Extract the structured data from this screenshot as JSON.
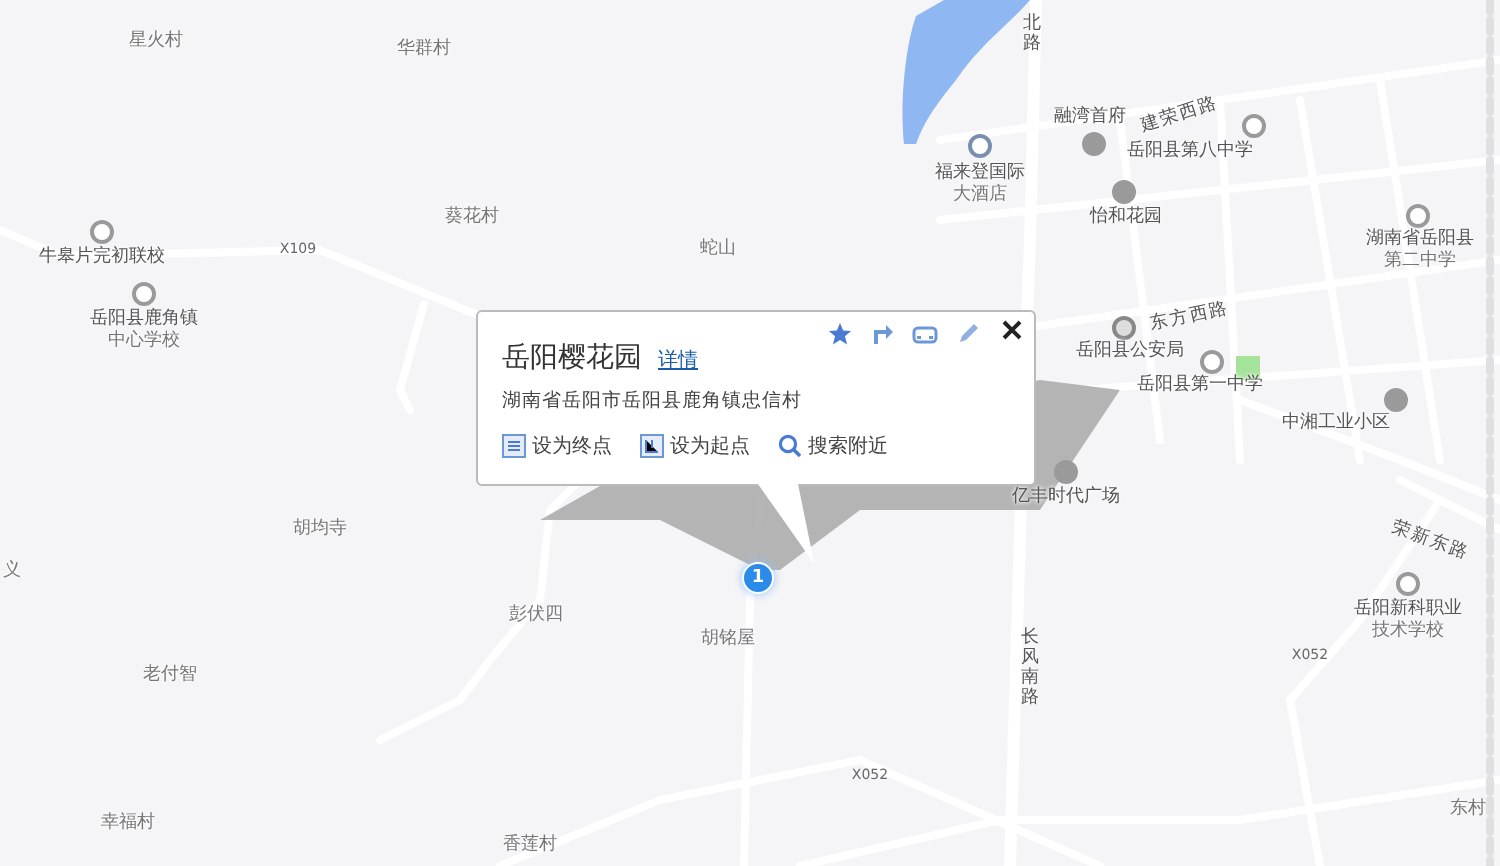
{
  "map": {
    "labels": [
      {
        "text": "星火村",
        "kind": "place"
      },
      {
        "text": "华群村",
        "kind": "place"
      },
      {
        "text": "葵花村",
        "kind": "place"
      },
      {
        "text": "蛇山",
        "kind": "place"
      },
      {
        "text": "牛皋片完初联校",
        "kind": "school"
      },
      {
        "text": "岳阳县鹿角镇",
        "kind": "school"
      },
      {
        "text": "中心学校",
        "kind": "place"
      },
      {
        "text": "X109",
        "kind": "road_code"
      },
      {
        "text": "福来登国际",
        "kind": "hotel"
      },
      {
        "text": "大酒店",
        "kind": "place"
      },
      {
        "text": "融湾首府",
        "kind": "residence"
      },
      {
        "text": "建荣西路",
        "kind": "road"
      },
      {
        "text": "岳阳县第八中学",
        "kind": "school"
      },
      {
        "text": "怡和花园",
        "kind": "residence"
      },
      {
        "text": "湖南省岳阳县",
        "kind": "school"
      },
      {
        "text": "第二中学",
        "kind": "place"
      },
      {
        "text": "东方西路",
        "kind": "road"
      },
      {
        "text": "岳阳县公安局",
        "kind": "police"
      },
      {
        "text": "岳阳县第一中学",
        "kind": "school"
      },
      {
        "text": "中湘工业小区",
        "kind": "residence"
      },
      {
        "text": "亿丰时代广场",
        "kind": "residence"
      },
      {
        "text": "荣新东路",
        "kind": "road"
      },
      {
        "text": "岳阳新科职业",
        "kind": "school"
      },
      {
        "text": "技术学校",
        "kind": "place"
      },
      {
        "text": "X052",
        "kind": "road_code"
      },
      {
        "text": "长风南路",
        "kind": "road_vertical"
      },
      {
        "text": "X052",
        "kind": "road_code"
      },
      {
        "text": "胡均寺",
        "kind": "place"
      },
      {
        "text": "义",
        "kind": "place"
      },
      {
        "text": "彭伏四",
        "kind": "place"
      },
      {
        "text": "胡铭屋",
        "kind": "place"
      },
      {
        "text": "老付智",
        "kind": "place"
      },
      {
        "text": "幸福村",
        "kind": "place"
      },
      {
        "text": "香莲村",
        "kind": "place"
      },
      {
        "text": "东村",
        "kind": "place"
      },
      {
        "text": "北路",
        "kind": "road_vertical"
      }
    ],
    "marker": {
      "label": "1"
    },
    "popup": {
      "title": "岳阳樱花园",
      "detail_link": "详情",
      "address": "湖南省岳阳市岳阳县鹿角镇忠信村",
      "actions": [
        {
          "label": "设为终点",
          "kind": "end"
        },
        {
          "label": "设为起点",
          "kind": "start"
        },
        {
          "label": "搜索附近",
          "kind": "search"
        }
      ]
    }
  }
}
